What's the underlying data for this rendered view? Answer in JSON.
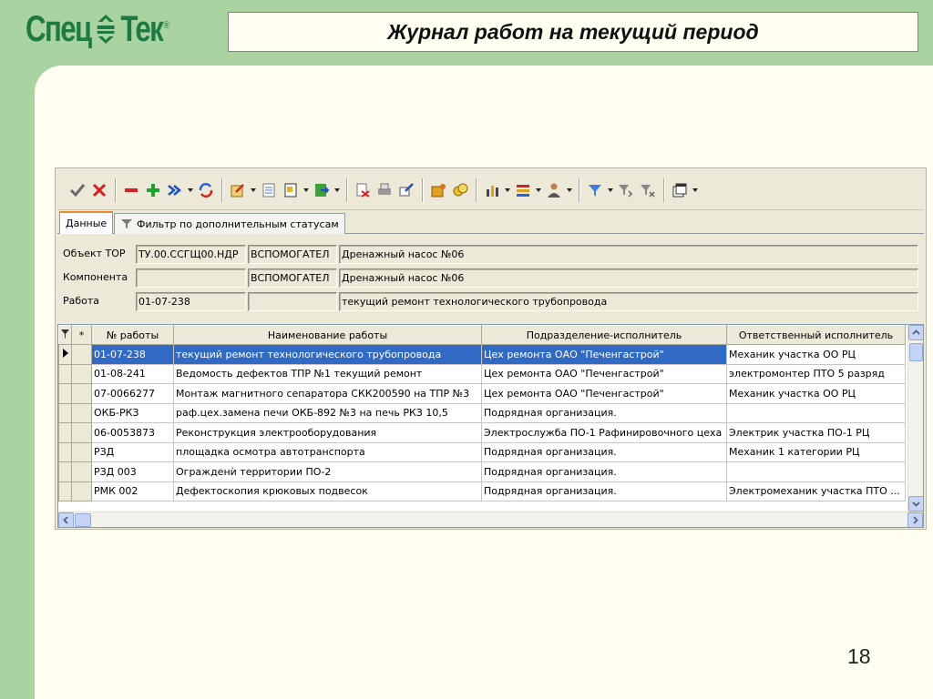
{
  "slide": {
    "logo_left": "Спец",
    "logo_right": "Тек",
    "logo_reg": "®",
    "title": "Журнал работ на текущий период",
    "page_number": "18"
  },
  "app": {
    "toolbar": {
      "icons": [
        "check-icon",
        "close-icon",
        "minus-icon",
        "plus-icon",
        "double-chevron-icon",
        "refresh-icon",
        "edit-icon",
        "list-icon",
        "document-icon",
        "export-icon",
        "delete-doc-icon",
        "print-icon",
        "send-icon",
        "box-icon",
        "coins-icon",
        "chart-icon",
        "list-colored-icon",
        "user-icon",
        "filter-icon",
        "filter-next-icon",
        "filter-clear-icon",
        "window-icon"
      ]
    },
    "tabs": [
      {
        "label": "Данные",
        "active": true
      },
      {
        "label": "Фильтр по дополнительным статусам",
        "active": false
      }
    ],
    "fields": {
      "object": {
        "label": "Объект ТОР",
        "code": "ТУ.00.ССГЩ00.НДР",
        "type": "ВСПОМОГАТЕЛ",
        "name": "Дренажный насос №06"
      },
      "component": {
        "label": "Компонента",
        "code": "",
        "type": "ВСПОМОГАТЕЛ",
        "name": "Дренажный насос №06"
      },
      "work": {
        "label": "Работа",
        "code": "01-07-238",
        "type": "",
        "name": "текущий ремонт технологического трубопровода"
      }
    },
    "grid": {
      "headers": {
        "filter": "",
        "star": "*",
        "work_no": "№ работы",
        "work_name": "Наименование работы",
        "dept": "Подразделение-исполнитель",
        "resp": "Ответственный исполнитель"
      },
      "rows": [
        {
          "no": "01-07-238",
          "name": "текущий ремонт технологического трубопровода",
          "dept": "Цех ремонта ОАО \"Печенгастрой\"",
          "resp": "Механик участка ОО РЦ"
        },
        {
          "no": "01-08-241",
          "name": "Ведомость дефектов ТПР №1 текущий ремонт",
          "dept": "Цех ремонта ОАО \"Печенгастрой\"",
          "resp": " электромонтер ПТО 5 разряд"
        },
        {
          "no": "07-0066277",
          "name": "Монтаж магнитного сепаратора СКК200590 на ТПР №3",
          "dept": "Цех ремонта ОАО \"Печенгастрой\"",
          "resp": "Механик участка ОО РЦ"
        },
        {
          "no": "ОКБ-РКЗ",
          "name": "раф.цех.замена печи ОКБ-892 №3 на печь РКЗ 10,5",
          "dept": "Подрядная организация.",
          "resp": ""
        },
        {
          "no": "06-0053873",
          "name": "Реконструкция электрооборудования",
          "dept": "Электрослужба ПО-1 Рафинировочного цеха",
          "resp": "Электрик участка ПО-1 РЦ"
        },
        {
          "no": "РЗД",
          "name": "площадка осмотра автотранспорта",
          "dept": "Подрядная организация.",
          "resp": " Механик 1 категории  РЦ"
        },
        {
          "no": "РЗД 003",
          "name": "Огражденѝ территории  ПО-2",
          "dept": "Подрядная организация.",
          "resp": ""
        },
        {
          "no": "РМК 002",
          "name": "Дефектоскопия крюковых подвесок",
          "dept": "Подрядная организация.",
          "resp": "Электромеханик участка ПТО ..."
        }
      ]
    }
  }
}
